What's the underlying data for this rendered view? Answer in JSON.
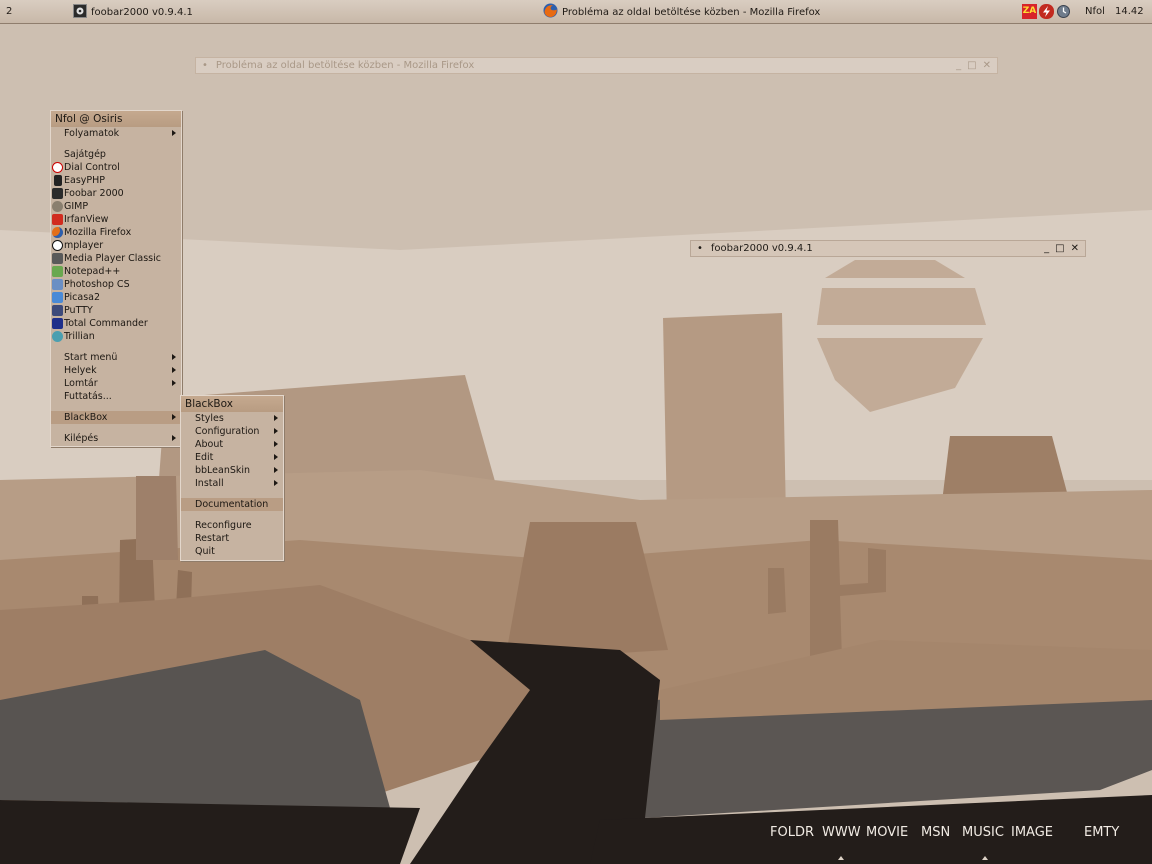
{
  "taskbar": {
    "workspace": "2",
    "tasks": [
      {
        "label": "foobar2000 v0.9.4.1",
        "icon": "foobar-icon"
      },
      {
        "label": "Probléma az oldal betöltése közben - Mozilla Firefox",
        "icon": "firefox-icon"
      }
    ],
    "tray": [
      {
        "glyph": "ZA",
        "icon": "zonealarm-icon"
      },
      {
        "glyph": "",
        "icon": "flash-icon"
      },
      {
        "glyph": "",
        "icon": "clock-icon"
      }
    ],
    "user": "Nfol",
    "time": "14.42"
  },
  "windows": {
    "firefox": {
      "title": "Probléma az oldal betöltése közben - Mozilla Firefox",
      "dot": "•"
    },
    "foobar": {
      "title": "foobar2000 v0.9.4.1",
      "dot": "•"
    },
    "buttons": {
      "minimize": "_",
      "maximize": "□",
      "close": "✕"
    }
  },
  "main_menu": {
    "title": "Nfol @ Osiris",
    "top": [
      {
        "label": "Folyamatok",
        "submenu": true
      }
    ],
    "apps": [
      {
        "label": "Sajátgép",
        "icon": ""
      },
      {
        "label": "Dial Control",
        "icon": "dial-control-icon"
      },
      {
        "label": "EasyPHP",
        "icon": "easyphp-icon"
      },
      {
        "label": "Foobar 2000",
        "icon": "foobar-icon"
      },
      {
        "label": "GIMP",
        "icon": "gimp-icon"
      },
      {
        "label": "IrfanView",
        "icon": "irfanview-icon"
      },
      {
        "label": "Mozilla Firefox",
        "icon": "firefox-icon"
      },
      {
        "label": "mplayer",
        "icon": "mplayer-icon"
      },
      {
        "label": "Media Player Classic",
        "icon": "media-player-classic-icon"
      },
      {
        "label": "Notepad++",
        "icon": "notepadpp-icon"
      },
      {
        "label": "Photoshop CS",
        "icon": "photoshop-icon"
      },
      {
        "label": "Picasa2",
        "icon": "picasa-icon"
      },
      {
        "label": "PuTTY",
        "icon": "putty-icon"
      },
      {
        "label": "Total Commander",
        "icon": "total-commander-icon"
      },
      {
        "label": "Trillian",
        "icon": "trillian-icon"
      }
    ],
    "nav": [
      {
        "label": "Start menü",
        "submenu": true
      },
      {
        "label": "Helyek",
        "submenu": true
      },
      {
        "label": "Lomtár",
        "submenu": true
      },
      {
        "label": "Futtatás...",
        "submenu": false
      }
    ],
    "blackbox": {
      "label": "BlackBox",
      "submenu": true
    },
    "exit": {
      "label": "Kilépés",
      "submenu": true
    }
  },
  "blackbox_menu": {
    "title": "BlackBox",
    "items": [
      {
        "label": "Styles",
        "submenu": true
      },
      {
        "label": "Configuration",
        "submenu": true
      },
      {
        "label": "About",
        "submenu": true
      },
      {
        "label": "Edit",
        "submenu": true
      },
      {
        "label": "bbLeanSkin",
        "submenu": true
      },
      {
        "label": "Install",
        "submenu": true
      }
    ],
    "documentation": "Documentation",
    "actions": [
      "Reconfigure",
      "Restart",
      "Quit"
    ]
  },
  "dock": [
    "FOLDR",
    "WWW",
    "MOVIE",
    "MSN",
    "MUSIC",
    "IMAGE",
    "EMTY"
  ],
  "colors": {
    "menu_bg": "#c6b3a1",
    "menu_title": "#b89c82",
    "highlight": "#b99d84",
    "sky": "#cdbfb1",
    "road": "#231d1a"
  }
}
